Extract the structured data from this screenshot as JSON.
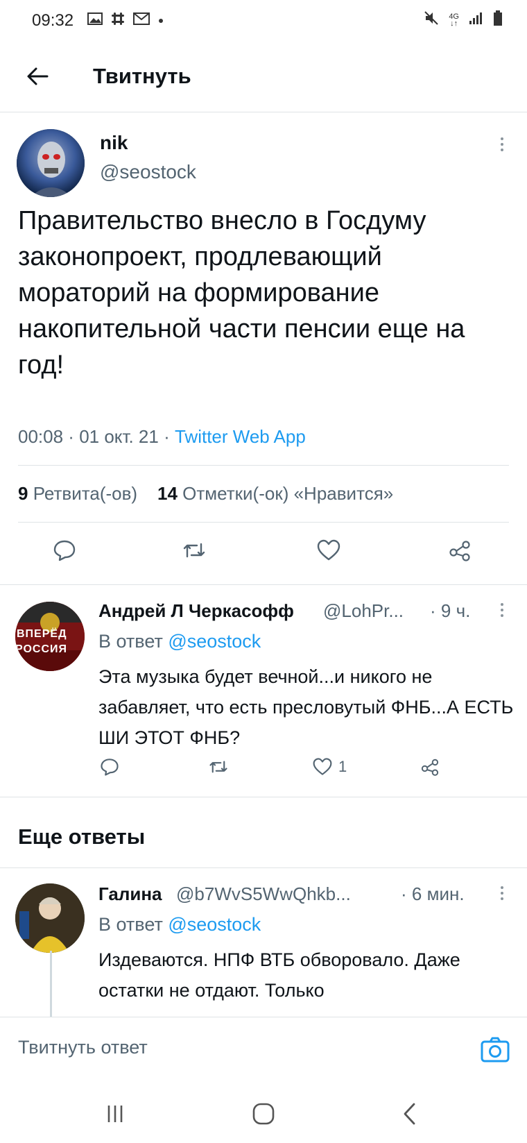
{
  "status_bar": {
    "time": "09:32",
    "network": "4G"
  },
  "header": {
    "title": "Твитнуть"
  },
  "main_tweet": {
    "author_name": "nik",
    "author_handle": "@seostock",
    "text": "Правительство внесло в Госдуму законопроект, продлевающий мораторий на формирование накопительной части пенсии еще на год!",
    "time": "00:08",
    "date": "01 окт. 21",
    "app": "Twitter Web App",
    "retweets_count": "9",
    "retweets_label": "Ретвита(-ов)",
    "likes_count": "14",
    "likes_label": "Отметки(-ок) «Нравится»"
  },
  "replies": [
    {
      "author_name": "Андрей Л Черкасофф",
      "author_handle": "@LohPr...",
      "time": "· 9 ч.",
      "reply_to_prefix": "В ответ",
      "reply_to_handle": "@seostock",
      "text": "Эта музыка будет вечной...и никого не забавляет, что есть пресловутый ФНБ...А ЕСТЬ ШИ ЭТОТ ФНБ?",
      "avatar_text_top": "ВПЕРЁД",
      "avatar_text_bottom": "РОССИЯ",
      "like_count": "1"
    }
  ],
  "more_replies": {
    "title": "Еще ответы",
    "items": [
      {
        "author_name": "Галина",
        "author_handle": "@b7WvS5WwQhkb...",
        "time": "· 6 мин.",
        "reply_to_prefix": "В ответ",
        "reply_to_handle": "@seostock",
        "text": "Издеваются. НПФ ВТБ обворовало. Даже остатки не отдают. Только"
      }
    ]
  },
  "composer": {
    "placeholder": "Твитнуть ответ"
  },
  "colors": {
    "accent": "#1d9bf0",
    "text": "#0f1419",
    "muted": "#536471",
    "divider": "#dfe3e6"
  }
}
